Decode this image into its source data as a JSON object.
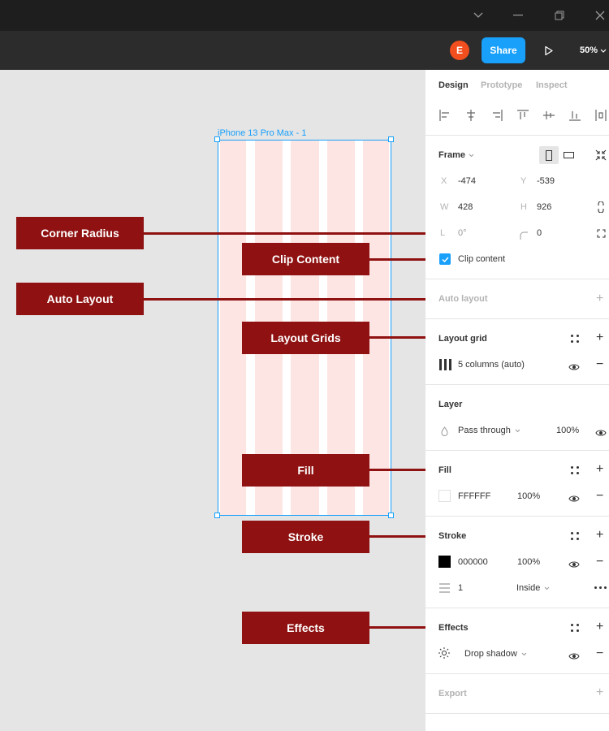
{
  "toolbar": {
    "avatar_initial": "E",
    "share_label": "Share",
    "zoom_level": "50%"
  },
  "canvas": {
    "frame_label": "iPhone 13 Pro Max - 1",
    "grid_columns": 5,
    "grid_color": "#fde5e3",
    "selection_color": "#18a0fb"
  },
  "annotations": {
    "color": "#8f1111",
    "corner_radius": "Corner Radius",
    "clip_content": "Clip Content",
    "auto_layout": "Auto Layout",
    "layout_grids": "Layout Grids",
    "fill": "Fill",
    "stroke": "Stroke",
    "effects": "Effects"
  },
  "panel": {
    "tabs": {
      "design": "Design",
      "prototype": "Prototype",
      "inspect": "Inspect"
    },
    "frame": {
      "title": "Frame",
      "x_label": "X",
      "x_value": "-474",
      "y_label": "Y",
      "y_value": "-539",
      "w_label": "W",
      "w_value": "428",
      "h_label": "H",
      "h_value": "926",
      "rotation_label": "L",
      "rotation_value": "0°",
      "radius_value": "0",
      "clip_label": "Clip content"
    },
    "auto_layout": {
      "title": "Auto layout"
    },
    "layout_grid": {
      "title": "Layout grid",
      "value": "5 columns (auto)"
    },
    "layer": {
      "title": "Layer",
      "blend": "Pass through",
      "opacity": "100%"
    },
    "fill": {
      "title": "Fill",
      "hex": "FFFFFF",
      "opacity": "100%",
      "color": "#ffffff"
    },
    "stroke": {
      "title": "Stroke",
      "hex": "000000",
      "opacity": "100%",
      "color": "#000000",
      "weight": "1",
      "position": "Inside"
    },
    "effects": {
      "title": "Effects",
      "type": "Drop shadow"
    },
    "export": {
      "title": "Export"
    }
  }
}
